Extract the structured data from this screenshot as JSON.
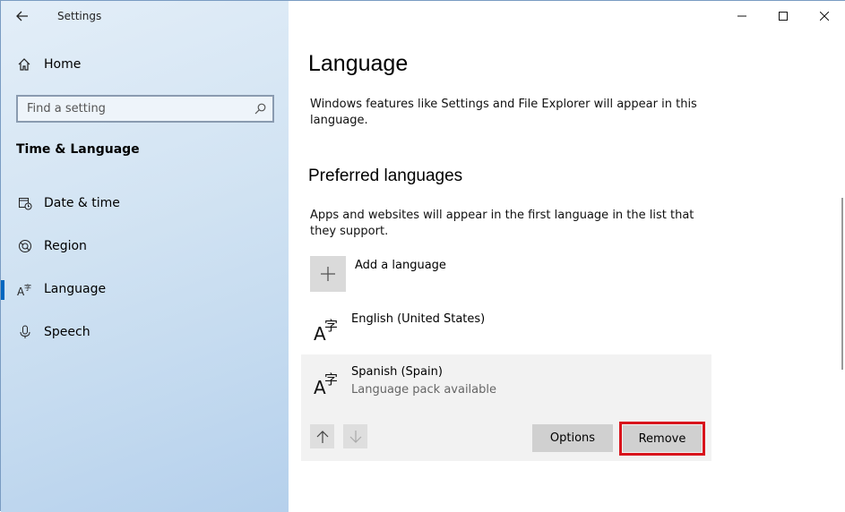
{
  "window": {
    "title": "Settings",
    "controls": {
      "minimize": "minimize-icon",
      "maximize": "maximize-icon",
      "close": "close-icon"
    }
  },
  "sidebar": {
    "home_label": "Home",
    "search_placeholder": "Find a setting",
    "section_title": "Time & Language",
    "items": [
      {
        "label": "Date & time",
        "icon": "calendar-clock-icon"
      },
      {
        "label": "Region",
        "icon": "globe-icon"
      },
      {
        "label": "Language",
        "icon": "language-icon",
        "active": true
      },
      {
        "label": "Speech",
        "icon": "microphone-icon"
      }
    ],
    "accent": "#0067c0"
  },
  "main": {
    "title": "Language",
    "description": "Windows features like Settings and File Explorer will appear in this language.",
    "preferred_heading": "Preferred languages",
    "preferred_description": "Apps and websites will appear in the first language in the list that they support.",
    "add_language_label": "Add a language",
    "languages": [
      {
        "name": "English (United States)",
        "status": ""
      },
      {
        "name": "Spanish (Spain)",
        "status": "Language pack available"
      }
    ],
    "options_label": "Options",
    "remove_label": "Remove",
    "highlight_color": "#d8141c"
  }
}
